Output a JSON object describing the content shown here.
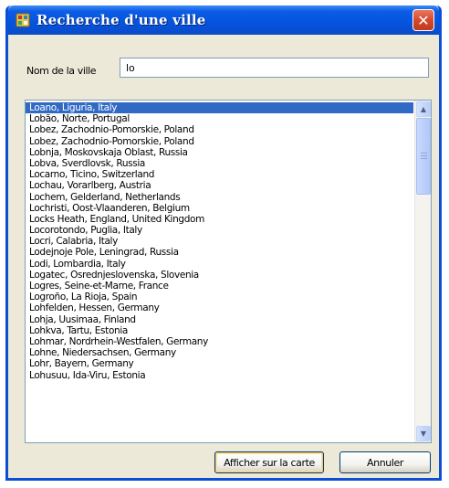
{
  "window": {
    "title": "Recherche d'une ville",
    "close_glyph": "✕"
  },
  "search": {
    "label": "Nom de la ville",
    "value": "lo"
  },
  "cities": [
    "Loano, Liguria, Italy",
    "Lobão, Norte, Portugal",
    "Lobez, Zachodnio-Pomorskie, Poland",
    "Lobez, Zachodnio-Pomorskie, Poland",
    "Lobnja, Moskovskaja Oblast, Russia",
    "Lobva, Sverdlovsk, Russia",
    "Locarno, Ticino, Switzerland",
    "Lochau, Vorarlberg, Austria",
    "Lochem, Gelderland, Netherlands",
    "Lochristi, Oost-Vlaanderen, Belgium",
    "Locks Heath, England, United Kingdom",
    "Locorotondo, Puglia, Italy",
    "Locri, Calabria, Italy",
    "Lodejnoje Pole, Leningrad, Russia",
    "Lodi, Lombardia, Italy",
    "Logatec, Osrednjeslovenska, Slovenia",
    "Logres, Seine-et-Marne, France",
    "Logroño, La Rioja, Spain",
    "Lohfelden, Hessen, Germany",
    "Lohja, Uusimaa, Finland",
    "Lohkva, Tartu, Estonia",
    "Lohmar, Nordrhein-Westfalen, Germany",
    "Lohne, Niedersachsen, Germany",
    "Lohr, Bayern, Germany",
    "Lohusuu, Ida-Viru, Estonia"
  ],
  "selected_index": 0,
  "scrollbar": {
    "up_glyph": "▲",
    "down_glyph": "▼"
  },
  "buttons": {
    "show_on_map": "Afficher sur la carte",
    "cancel": "Annuler"
  },
  "colors": {
    "titlebar": "#0553de",
    "selection": "#316ac5",
    "close_button": "#d6492b"
  }
}
